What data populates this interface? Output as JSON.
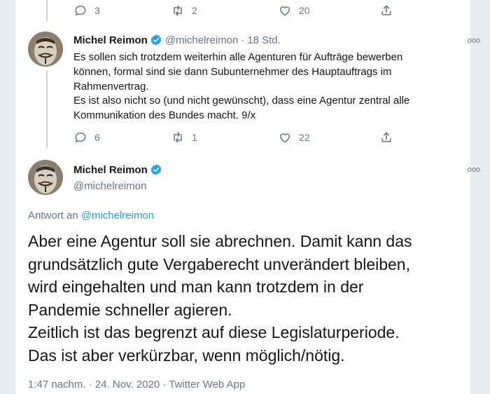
{
  "top_actions": {
    "reply_count": "3",
    "retweet_count": "2",
    "like_count": "20"
  },
  "reply_tweet": {
    "name": "Michel Reimon",
    "handle": "@michelreimon",
    "separator": "·",
    "time": "18 Std.",
    "lines": [
      "Es sollen sich trotzdem weiterhin alle Agenturen für Aufträge bewerben",
      "können, formal sind sie dann Subunternehmer des Hauptauftrags im",
      "Rahmenvertrag.",
      "Es ist also nicht so (und nicht gewünscht), dass eine Agentur zentral alle",
      "Kommunikation des Bundes macht. 9/x"
    ],
    "reply_count": "6",
    "retweet_count": "1",
    "like_count": "22"
  },
  "main_tweet": {
    "name": "Michel Reimon",
    "handle": "@michelreimon",
    "reply_to_prefix": "Antwort an",
    "reply_to_handle": "@michelreimon",
    "lines": [
      "Aber eine Agentur soll sie abrechnen. Damit kann das",
      "grundsätzlich gute Vergaberecht unverändert bleiben,",
      "wird eingehalten und man kann trotzdem in der",
      "Pandemie schneller agieren.",
      "Zeitlich ist das begrenzt auf diese Legislaturperiode.",
      "Das ist aber verkürzbar, wenn möglich/nötig."
    ],
    "time": "1:47 nachm.",
    "separator1": "·",
    "date": "24. Nov. 2020",
    "separator2": "·",
    "source": "Twitter Web App"
  },
  "colors": {
    "accent": "#1da1f2",
    "muted": "#657786",
    "border": "#e6ecf0",
    "thread": "#ccd6dd"
  },
  "icons": [
    "reply-icon",
    "retweet-icon",
    "like-icon",
    "share-icon",
    "verified-icon",
    "more-icon"
  ]
}
